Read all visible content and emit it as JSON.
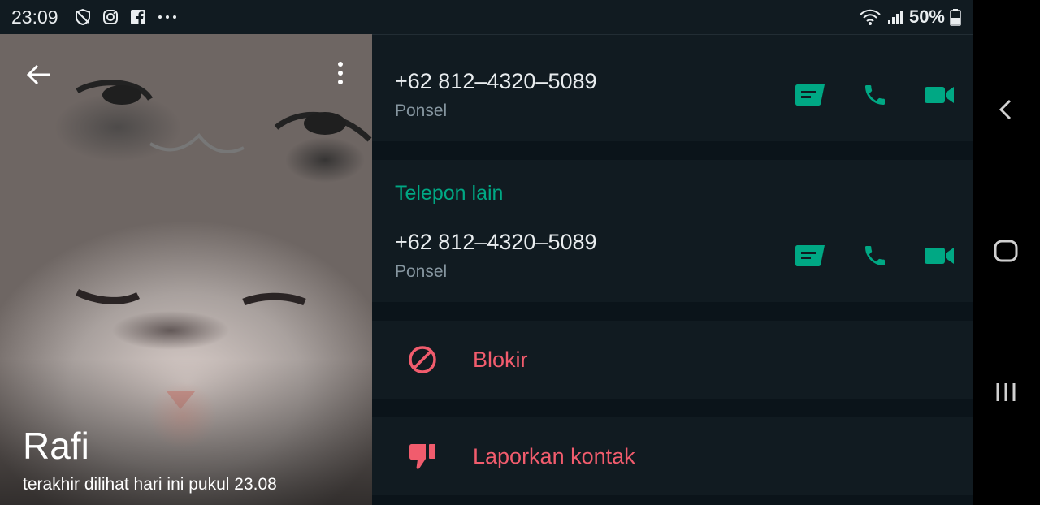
{
  "status_bar": {
    "time": "23:09",
    "left_icons": [
      "shield-icon",
      "instagram-icon",
      "facebook-icon",
      "more-horizontal-icon"
    ],
    "right_icons": [
      "wifi-icon",
      "signal-icon",
      "battery-icon"
    ],
    "battery": "50%"
  },
  "profile": {
    "name": "Rafi",
    "last_seen": "terakhir dilihat hari ini pukul 23.08"
  },
  "primary_phone": {
    "number": "+62 812–4320–5089",
    "type": "Ponsel"
  },
  "other_phones": {
    "label": "Telepon lain",
    "number": "+62 812–4320–5089",
    "type": "Ponsel"
  },
  "actions": {
    "block": "Blokir",
    "report": "Laporkan kontak"
  },
  "colors": {
    "accent": "#00a884",
    "danger": "#f15c6d",
    "background": "#0b141a",
    "card": "#111b21"
  }
}
